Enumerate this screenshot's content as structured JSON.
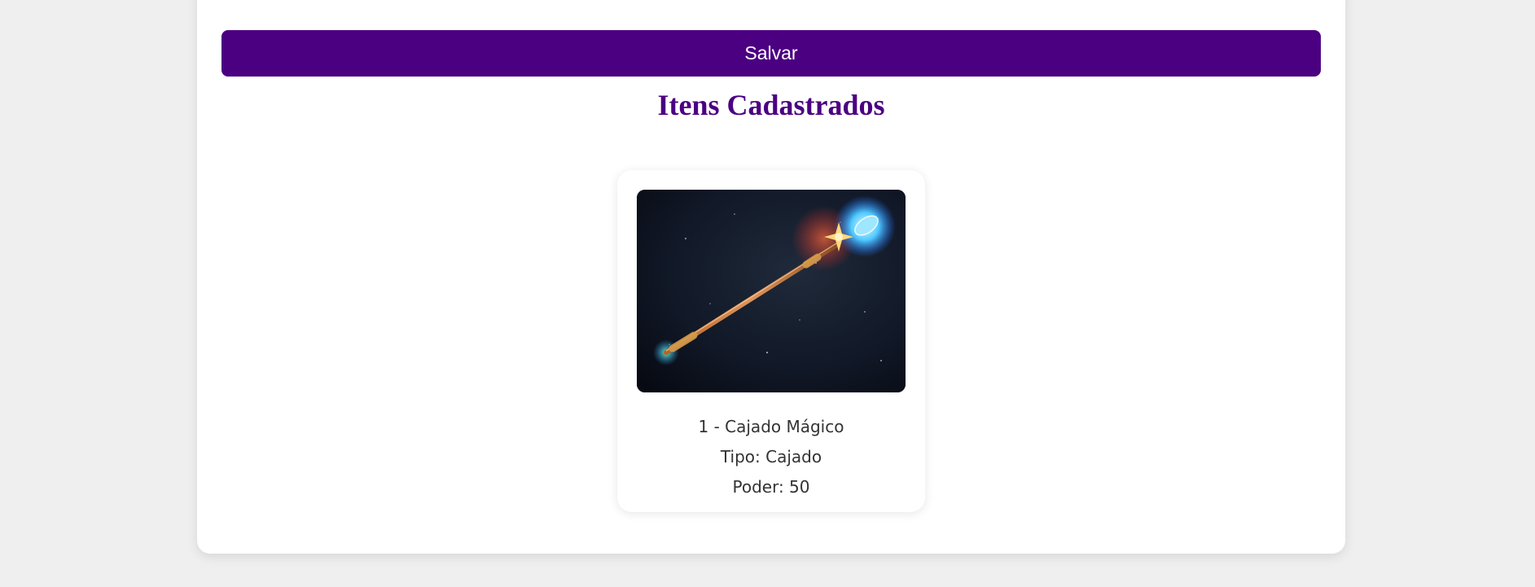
{
  "form": {
    "save_label": "Salvar"
  },
  "items_section": {
    "title": "Itens Cadastrados",
    "items": [
      {
        "heading": "1 - Cajado Mágico",
        "type_line": "Tipo: Cajado",
        "power_line": "Poder: 50",
        "image_alt": "Cajado Mágico"
      }
    ]
  },
  "colors": {
    "accent": "#4b0082",
    "page_background": "#efefef",
    "card_background": "#ffffff",
    "text": "#333333"
  }
}
